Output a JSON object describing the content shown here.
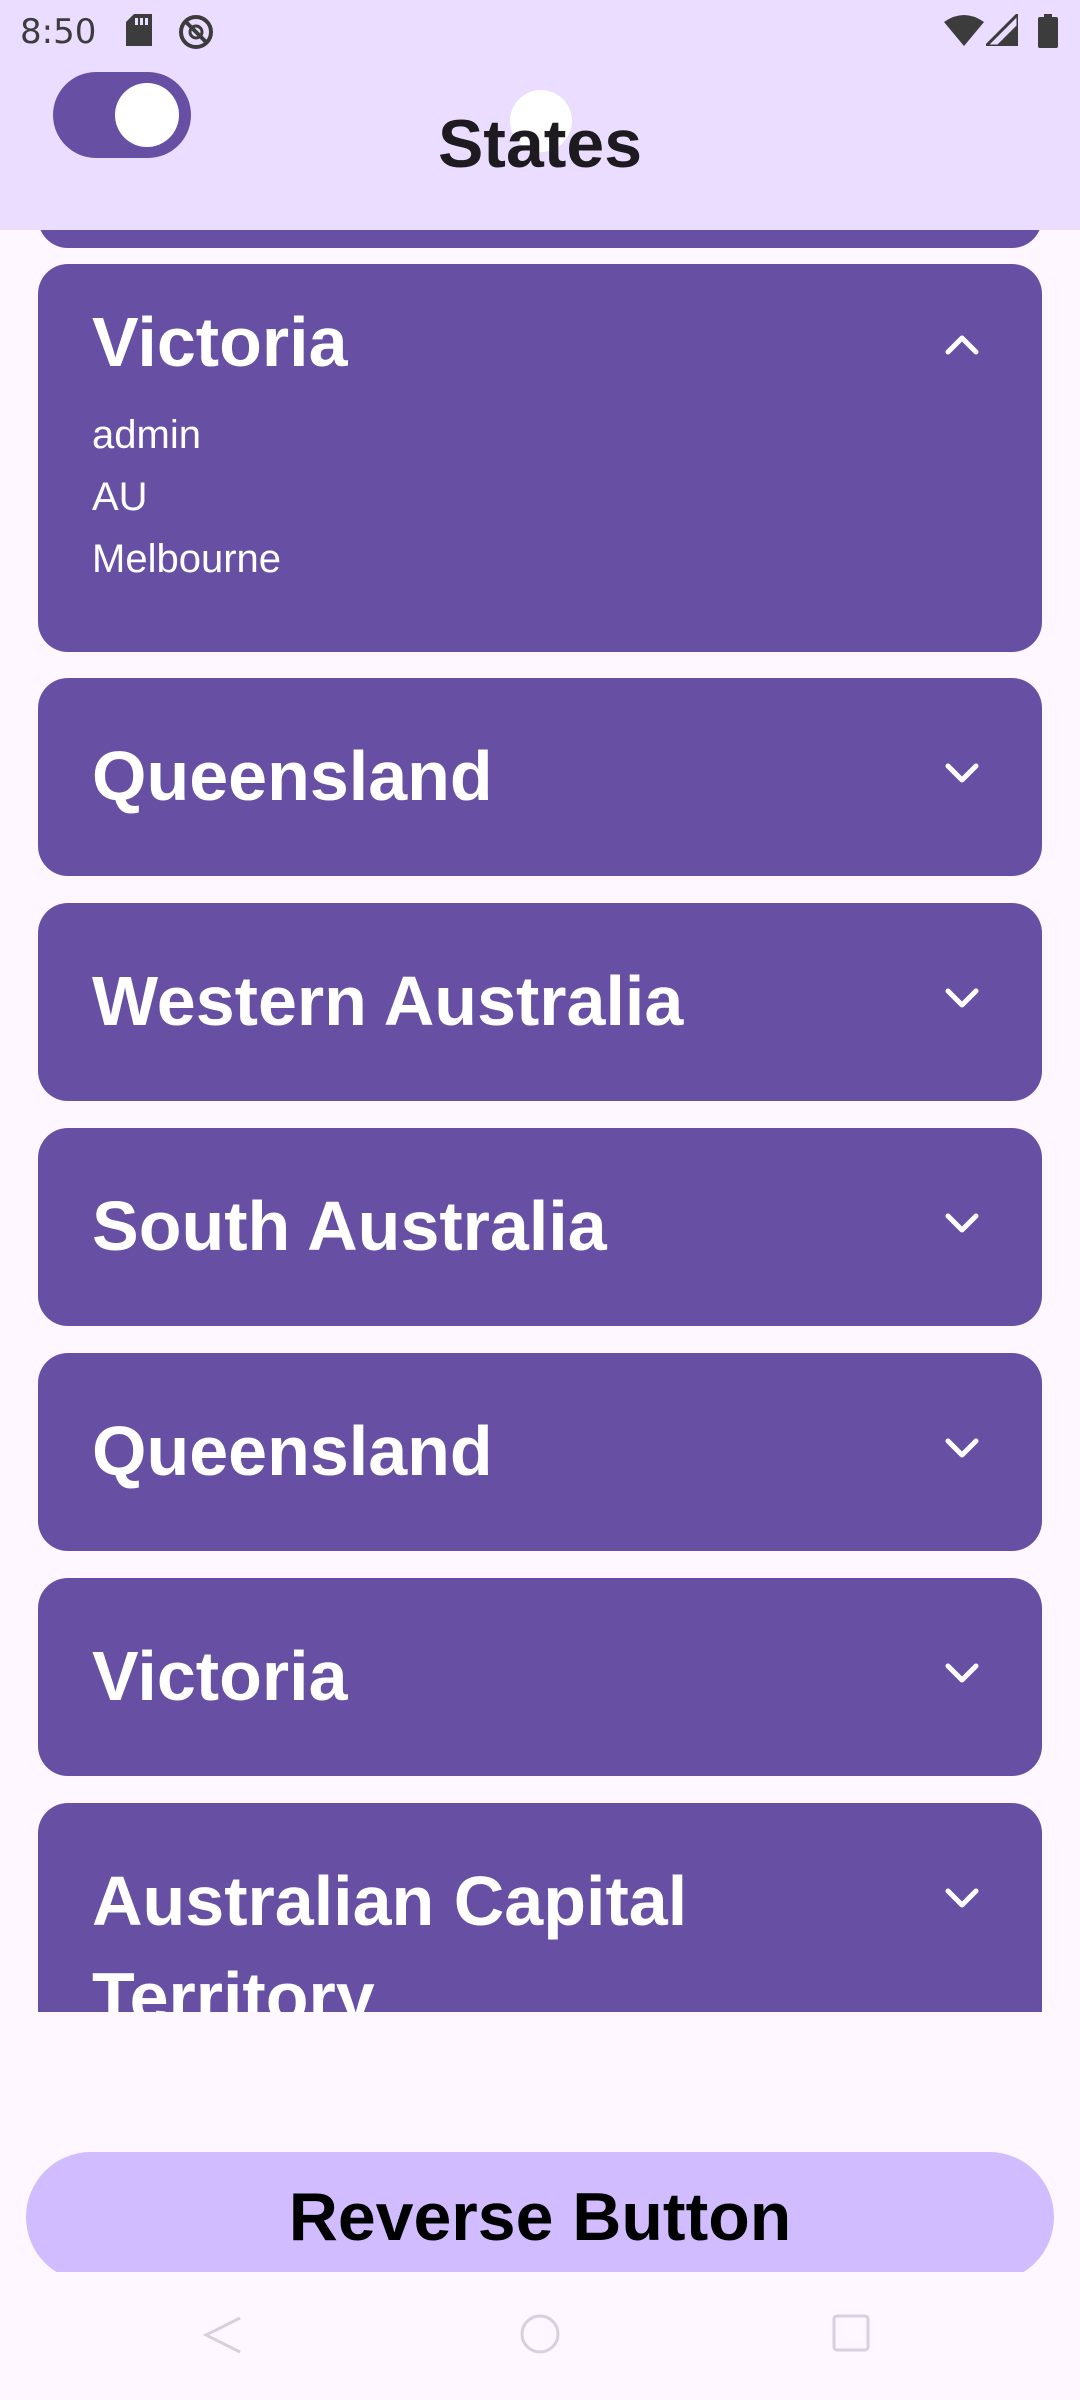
{
  "status_bar": {
    "time": "8:50",
    "icons": [
      "sd-card-icon",
      "do-not-disturb-icon",
      "wifi-icon",
      "signal-icon",
      "battery-icon"
    ]
  },
  "app_bar": {
    "title": "States",
    "toggle_on": true
  },
  "colors": {
    "card": "#6750A4",
    "app_bar": "#EADDFF",
    "background": "#FEF7FF",
    "button": "#D0BCFF"
  },
  "cards": [
    {
      "title": "Victoria",
      "expanded": true,
      "details": [
        "admin",
        "AU",
        "Melbourne"
      ]
    },
    {
      "title": "Queensland",
      "expanded": false
    },
    {
      "title": "Western Australia",
      "expanded": false
    },
    {
      "title": "South Australia",
      "expanded": false
    },
    {
      "title": "Queensland",
      "expanded": false
    },
    {
      "title": "Victoria",
      "expanded": false
    },
    {
      "title": "Australian Capital Territory",
      "expanded": false
    }
  ],
  "bottom": {
    "reverse_label": "Reverse Button"
  }
}
